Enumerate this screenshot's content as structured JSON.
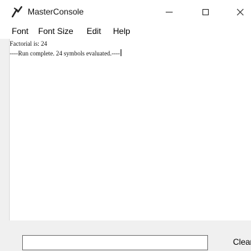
{
  "window": {
    "title": "MasterConsole"
  },
  "menu": {
    "font": "Font",
    "font_size": "Font Size",
    "edit": "Edit",
    "help": "Help"
  },
  "console": {
    "lines": [
      "Factorial is: 24",
      "----Run complete.  24 symbols evaluated.----"
    ]
  },
  "input": {
    "value": ""
  },
  "buttons": {
    "clear": "Clear"
  }
}
